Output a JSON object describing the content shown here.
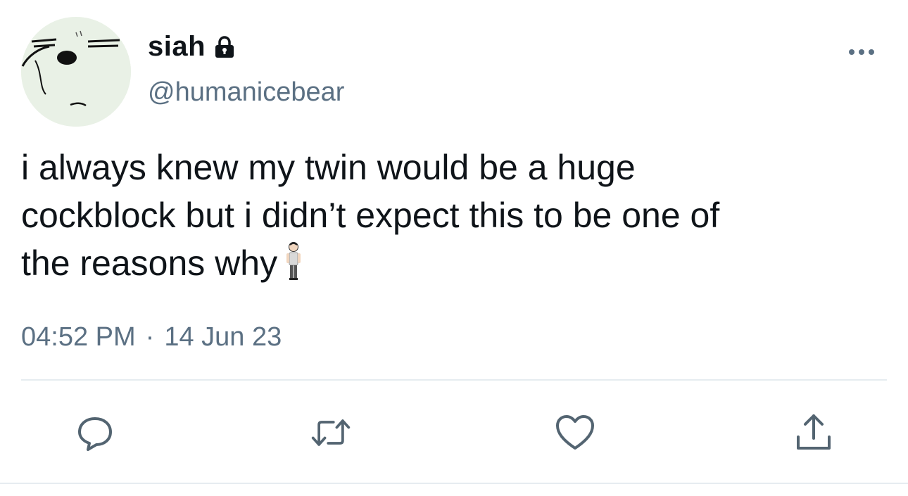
{
  "tweet": {
    "author": {
      "display_name": "siah",
      "handle": "@humanicebear",
      "protected_icon": "lock-icon",
      "avatar_icon": "bear-face-avatar"
    },
    "text_lines": [
      "i always knew my twin would be a huge",
      "cockblock but i didn’t expect this to be one of",
      "the reasons why"
    ],
    "emoji": "standing-person-emoji",
    "time": "04:52 PM",
    "separator": "·",
    "date": "14 Jun 23"
  },
  "actions": [
    {
      "icon": "reply-icon"
    },
    {
      "icon": "retweet-icon"
    },
    {
      "icon": "heart-icon"
    },
    {
      "icon": "share-icon"
    }
  ],
  "menu_icon": "more-options-icon",
  "colors": {
    "text": "#0f1419",
    "secondary": "#5b7083",
    "divider": "#e6ecf0",
    "icon": "#536471",
    "avatar_bg": "#e9f1e6"
  }
}
